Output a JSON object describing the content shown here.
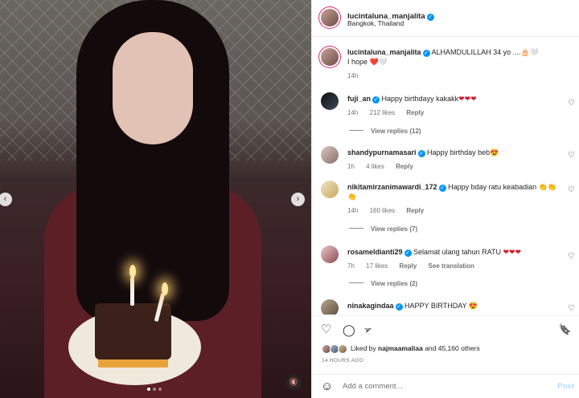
{
  "media": {
    "prev_icon": "‹",
    "next_icon": "›",
    "mute_icon": "🔇"
  },
  "header": {
    "username": "lucintaluna_manjalita",
    "location": "Bangkok, Thailand",
    "more_icon": "•••"
  },
  "caption": {
    "username": "lucintaluna_manjalita",
    "text_line1": "ALHAMDULILLAH 34 yo ....🎂🤍",
    "text_line2": "I hope ❤️🤍",
    "time": "14h"
  },
  "comments": [
    {
      "username": "fuji_an",
      "verified": true,
      "text": "Happy birthdayy kakakk",
      "emoji": "❤❤❤",
      "time": "14h",
      "likes": "212 likes",
      "reply": "Reply",
      "view_replies": "View replies (12)"
    },
    {
      "username": "shandypurnamasari",
      "verified": true,
      "text": "Happy birthday beb",
      "emoji": "😍",
      "time": "1h",
      "likes": "4 likes",
      "reply": "Reply"
    },
    {
      "username": "nikitamirzanimawardi_172",
      "verified": true,
      "text": "Happy bday ratu keabadian",
      "emoji": "👏👏👏",
      "time": "14h",
      "likes": "160 likes",
      "reply": "Reply",
      "view_replies": "View replies (7)"
    },
    {
      "username": "rosameldianti29",
      "verified": true,
      "text": "Selamat ulang tahun RATU",
      "emoji": "❤❤❤",
      "time": "7h",
      "likes": "17 likes",
      "reply": "Reply",
      "translate": "See translation",
      "view_replies": "View replies (2)"
    },
    {
      "username": "ninakagindaa",
      "verified": true,
      "text": "HAPPY BIRTHDAY",
      "emoji": "😍"
    }
  ],
  "actions": {
    "like_icon": "♡",
    "comment_icon": "◯",
    "share_icon": "➢",
    "save_icon": "🔖"
  },
  "likes": {
    "prefix": "Liked by",
    "user": "najmaamaliaa",
    "suffix": "and 45,160 others"
  },
  "posted": "14 HOURS AGO",
  "composer": {
    "emoji_icon": "☺",
    "placeholder": "Add a comment…",
    "post_label": "Post"
  },
  "colors": {
    "accent": "#0095f6",
    "heart_red": "#d21d2d"
  }
}
